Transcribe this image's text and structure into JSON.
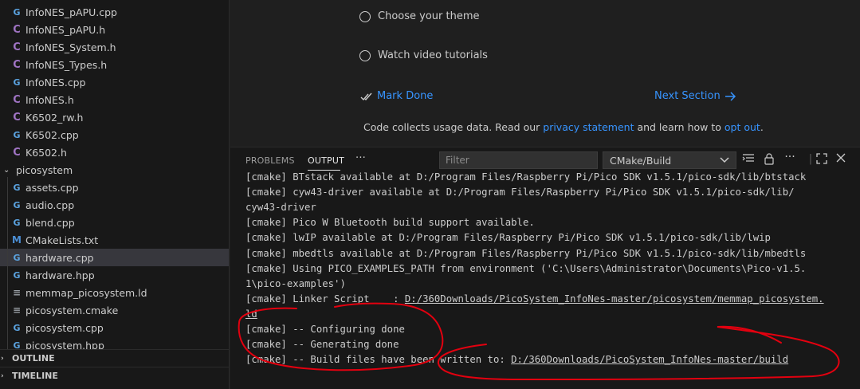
{
  "explorer": {
    "files_top": [
      {
        "name": "InfoNES_pAPU.cpp",
        "type": "cpp"
      },
      {
        "name": "InfoNES_pAPU.h",
        "type": "c"
      },
      {
        "name": "InfoNES_System.h",
        "type": "c"
      },
      {
        "name": "InfoNES_Types.h",
        "type": "c"
      },
      {
        "name": "InfoNES.cpp",
        "type": "cpp"
      },
      {
        "name": "InfoNES.h",
        "type": "c"
      },
      {
        "name": "K6502_rw.h",
        "type": "c"
      },
      {
        "name": "K6502.cpp",
        "type": "cpp"
      },
      {
        "name": "K6502.h",
        "type": "c"
      }
    ],
    "folder": "picosystem",
    "folder_files": [
      {
        "name": "assets.cpp",
        "type": "cpp"
      },
      {
        "name": "audio.cpp",
        "type": "cpp"
      },
      {
        "name": "blend.cpp",
        "type": "cpp"
      },
      {
        "name": "CMakeLists.txt",
        "type": "m"
      },
      {
        "name": "hardware.cpp",
        "type": "cpp",
        "selected": true
      },
      {
        "name": "hardware.hpp",
        "type": "cpp"
      },
      {
        "name": "memmap_picosystem.ld",
        "type": "txt"
      },
      {
        "name": "picosystem.cmake",
        "type": "txt"
      },
      {
        "name": "picosystem.cpp",
        "type": "cpp"
      },
      {
        "name": "picosystem.hpp",
        "type": "cpp"
      }
    ],
    "outline_label": "OUTLINE",
    "timeline_label": "TIMELINE"
  },
  "welcome": {
    "choose_theme": "Choose your theme",
    "watch_tutorials": "Watch video tutorials",
    "mark_done": "Mark Done",
    "next_section": "Next Section",
    "footer_prefix": "Code collects usage data. Read our ",
    "privacy_link": "privacy statement",
    "footer_mid": " and learn how to ",
    "opt_out_link": "opt out",
    "footer_suffix": "."
  },
  "panel": {
    "tabs": [
      "PROBLEMS",
      "OUTPUT"
    ],
    "active_tab": "OUTPUT",
    "more_label": "···",
    "filter_placeholder": "Filter",
    "channel": "CMake/Build",
    "output_lines": [
      {
        "text": "[cmake] BTstack available at D:/Program Files/Raspberry Pi/Pico SDK v1.5.1/pico-sdk/lib/btstack"
      },
      {
        "text": "[cmake] cyw43-driver available at D:/Program Files/Raspberry Pi/Pico SDK v1.5.1/pico-sdk/lib/"
      },
      {
        "text": "cyw43-driver"
      },
      {
        "text": "[cmake] Pico W Bluetooth build support available."
      },
      {
        "text": "[cmake] lwIP available at D:/Program Files/Raspberry Pi/Pico SDK v1.5.1/pico-sdk/lib/lwip"
      },
      {
        "text": "[cmake] mbedtls available at D:/Program Files/Raspberry Pi/Pico SDK v1.5.1/pico-sdk/lib/mbedtls"
      },
      {
        "text": "[cmake] Using PICO_EXAMPLES_PATH from environment ('C:\\Users\\Administrator\\Documents\\Pico-v1.5."
      },
      {
        "text": "1\\pico-examples')"
      },
      {
        "prefix": "[cmake] Linker Script    : ",
        "link": "D:/360Downloads/PicoSystem_InfoNes-master/picosystem/memmap_picosystem."
      },
      {
        "prefix": "",
        "link": "ld"
      },
      {
        "text": "[cmake] -- Configuring done"
      },
      {
        "text": "[cmake] -- Generating done"
      },
      {
        "prefix": "[cmake] -- Build files have been written to: ",
        "link": "D:/360Downloads/PicoSystem_InfoNes-master/build"
      }
    ]
  },
  "colors": {
    "accent_link": "#3794ff",
    "annotation": "#e3000f",
    "cpp_icon": "#5ba3e0",
    "header_icon": "#a074c4"
  }
}
